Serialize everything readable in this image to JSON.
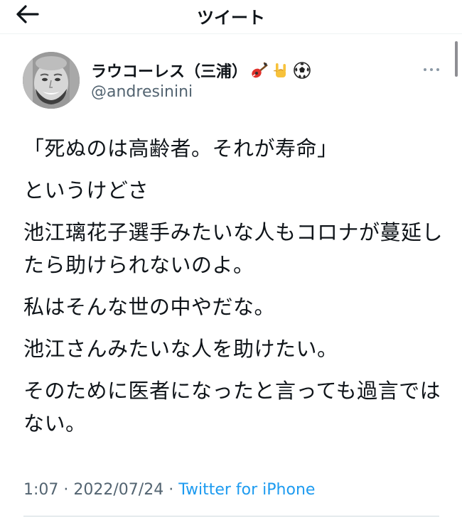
{
  "header": {
    "title": "ツイート",
    "back_icon": "arrow-left-icon"
  },
  "author": {
    "display_name": "ラウコーレス（三浦）",
    "emojis": [
      "guitar-emoji",
      "rock-hand-emoji",
      "soccer-ball-emoji"
    ],
    "handle": "@andresinini",
    "avatar": "user-avatar"
  },
  "more_icon": "more-dots-icon",
  "tweet": {
    "paragraphs": [
      "「死ぬのは高齢者。それが寿命」",
      "というけどさ",
      "池江璃花子選手みたいな人もコロナが蔓延したら助けられないのよ。",
      "私はそんな世の中やだな。",
      "池江さんみたいな人を助けたい。",
      "そのために医者になったと言っても過言ではない。"
    ]
  },
  "meta": {
    "time": "1:07",
    "separator": " · ",
    "date": "2022/07/24",
    "source": "Twitter for iPhone"
  },
  "colors": {
    "text": "#0f1419",
    "secondary": "#536471",
    "link": "#1d9bf0"
  }
}
